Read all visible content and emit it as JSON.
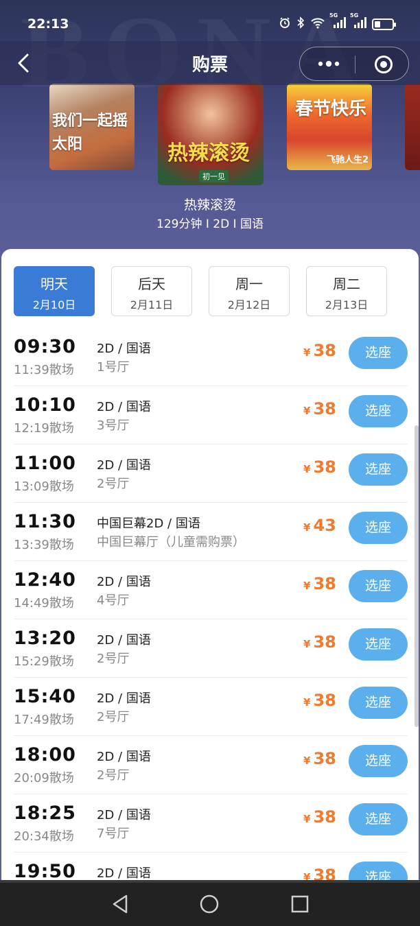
{
  "status": {
    "time": "22:13",
    "network_1": "5G",
    "network_2": "5G"
  },
  "navbar": {
    "title": "购票"
  },
  "watermark": "BONA",
  "posters": [
    {
      "title": "我们一起摇太阳"
    },
    {
      "title": "热辣滚烫",
      "badge": "初一见"
    },
    {
      "title": "春节快乐",
      "subtitle": "飞驰人生2"
    },
    {
      "title": ""
    }
  ],
  "movie": {
    "title": "热辣滚烫",
    "meta": "129分钟 I 2D I 国语"
  },
  "dates": [
    {
      "name": "明天",
      "date": "2月10日",
      "active": true
    },
    {
      "name": "后天",
      "date": "2月11日",
      "active": false
    },
    {
      "name": "周一",
      "date": "2月12日",
      "active": false
    },
    {
      "name": "周二",
      "date": "2月13日",
      "active": false
    }
  ],
  "currency": "¥",
  "seat_label": "选座",
  "showtimes": [
    {
      "start": "09:30",
      "end": "11:39散场",
      "format": "2D / 国语",
      "hall": "1号厅",
      "price": "38"
    },
    {
      "start": "10:10",
      "end": "12:19散场",
      "format": "2D / 国语",
      "hall": "3号厅",
      "price": "38"
    },
    {
      "start": "11:00",
      "end": "13:09散场",
      "format": "2D / 国语",
      "hall": "2号厅",
      "price": "38"
    },
    {
      "start": "11:30",
      "end": "13:39散场",
      "format": "中国巨幕2D / 国语",
      "hall": "中国巨幕厅（儿童需购票）",
      "price": "43"
    },
    {
      "start": "12:40",
      "end": "14:49散场",
      "format": "2D / 国语",
      "hall": "4号厅",
      "price": "38"
    },
    {
      "start": "13:20",
      "end": "15:29散场",
      "format": "2D / 国语",
      "hall": "2号厅",
      "price": "38"
    },
    {
      "start": "15:40",
      "end": "17:49散场",
      "format": "2D / 国语",
      "hall": "2号厅",
      "price": "38"
    },
    {
      "start": "18:00",
      "end": "20:09散场",
      "format": "2D / 国语",
      "hall": "2号厅",
      "price": "38"
    },
    {
      "start": "18:25",
      "end": "20:34散场",
      "format": "2D / 国语",
      "hall": "7号厅",
      "price": "38"
    },
    {
      "start": "19:50",
      "end": "",
      "format": "2D / 国语",
      "hall": "",
      "price": "38"
    }
  ],
  "colors": {
    "accent": "#3a7bd5",
    "seat_button": "#5aafec",
    "price": "#f07a2e"
  }
}
